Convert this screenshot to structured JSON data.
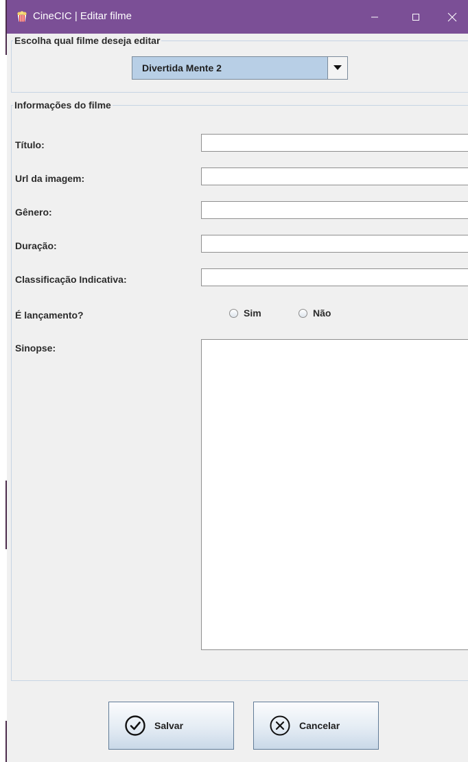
{
  "window": {
    "title": "CineCIC | Editar filme",
    "controls": {
      "minimize": "minimize-icon",
      "maximize": "maximize-icon",
      "close": "close-icon"
    }
  },
  "select_panel": {
    "legend": "Escolha qual filme deseja editar",
    "combo_value": "Divertida Mente 2"
  },
  "info_panel": {
    "legend": "Informações do filme",
    "fields": {
      "titulo": {
        "label": "Título:",
        "value": ""
      },
      "url": {
        "label": "Url da imagem:",
        "value": ""
      },
      "genero": {
        "label": "Gênero:",
        "value": ""
      },
      "duracao": {
        "label": "Duração:",
        "value": ""
      },
      "classificacao": {
        "label": "Classificação Indicativa:",
        "value": ""
      }
    },
    "lancamento": {
      "label": "É lançamento?",
      "options": [
        "Sim",
        "Não"
      ],
      "selected": null
    },
    "sinopse": {
      "label": "Sinopse:",
      "value": ""
    }
  },
  "buttons": {
    "save_label": "Salvar",
    "cancel_label": "Cancelar"
  },
  "colors": {
    "titlebar": "#7b4f96",
    "combo_selected": "#b8cfe6",
    "panel_border": "#c6d4e4"
  }
}
